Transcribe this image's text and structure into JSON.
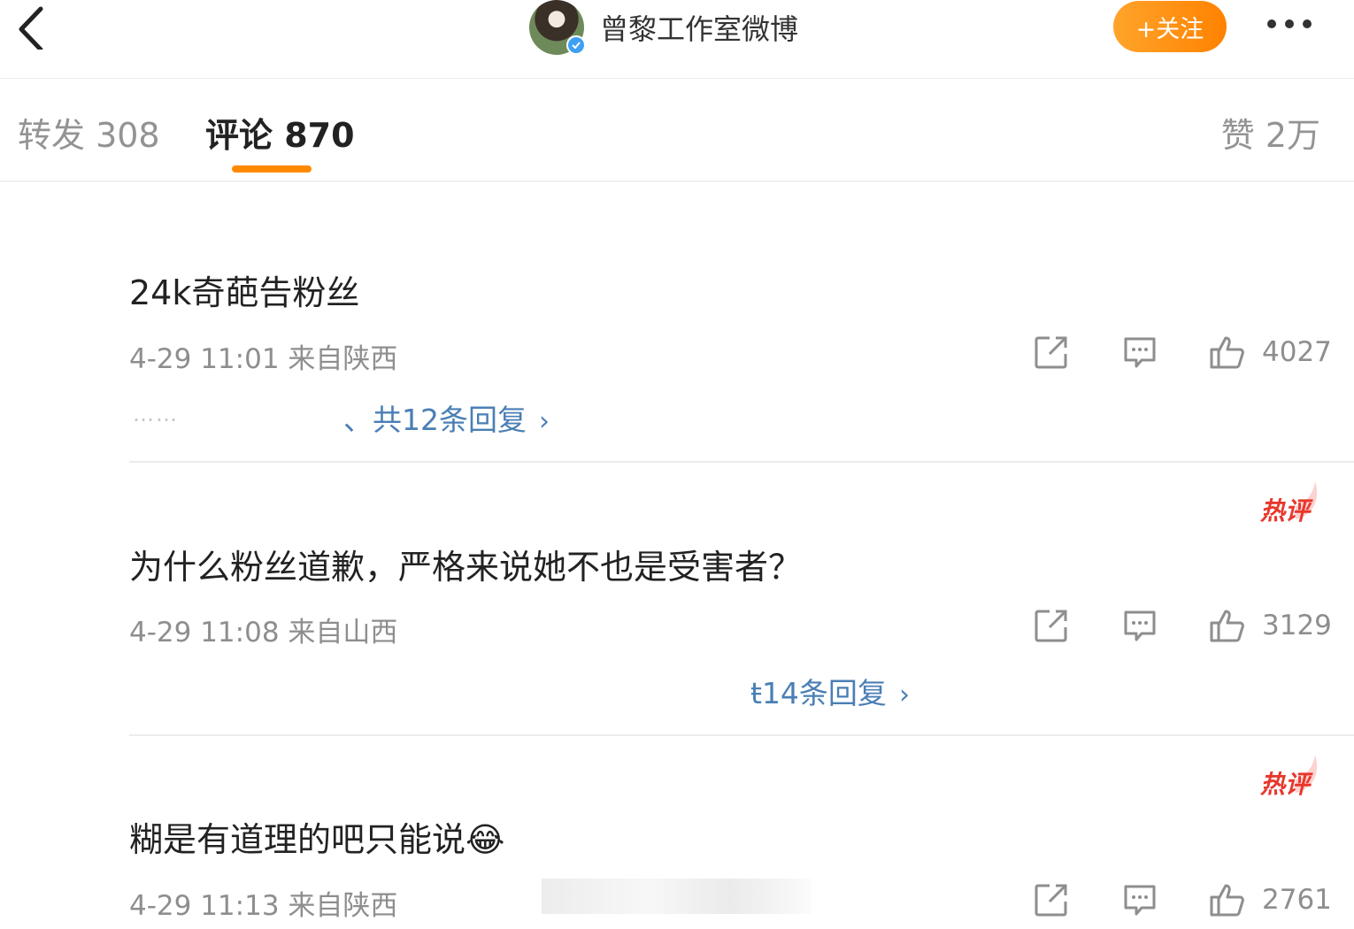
{
  "header": {
    "title": "曾黎工作室微博",
    "follow_label": "+关注"
  },
  "tabs": {
    "repost": "转发 308",
    "comments": "评论 870",
    "likes": "赞 2万"
  },
  "comments": [
    {
      "text": "24k奇葩告粉丝",
      "meta": "4-29 11:01 来自陕西",
      "likes": "4027",
      "replies": "共12条回复",
      "reply_prefix": "、"
    },
    {
      "text": "为什么粉丝道歉，严格来说她不也是受害者？",
      "meta": "4-29 11:08 来自山西",
      "likes": "3129",
      "replies": "ŧ14条回复",
      "hot_badge": "热评"
    },
    {
      "text": "糊是有道理的吧只能说",
      "emoji": "😂",
      "meta": "4-29 11:13 来自陕西",
      "likes": "2761",
      "hot_badge": "热评"
    }
  ],
  "colors": {
    "accent_orange": "#ff8200",
    "link_blue": "#4a7fb5",
    "hot_red": "#e8372c"
  }
}
